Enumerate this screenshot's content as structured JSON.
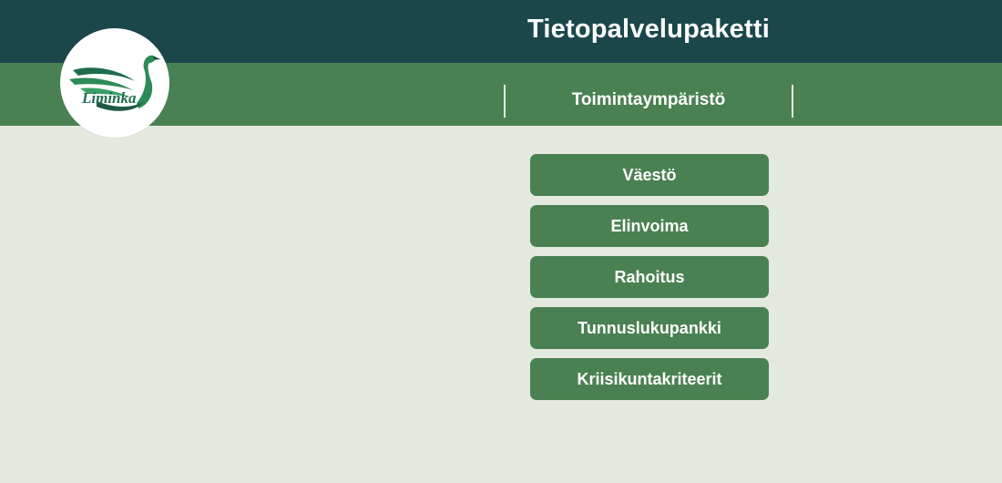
{
  "header": {
    "title": "Tietopalvelupaketti",
    "section_tab": "Toimintaympäristö"
  },
  "logo": {
    "text": "Liminka",
    "icon": "swan-logo-icon"
  },
  "navigation": {
    "buttons": [
      {
        "label": "Väestö"
      },
      {
        "label": "Elinvoima"
      },
      {
        "label": "Rahoitus"
      },
      {
        "label": "Tunnuslukupankki"
      },
      {
        "label": "Kriisikuntakriteerit"
      }
    ]
  },
  "colors": {
    "dark_teal": "#1b474b",
    "green": "#4a8152",
    "background": "#e4e9e0",
    "text_white": "#ffffff"
  }
}
